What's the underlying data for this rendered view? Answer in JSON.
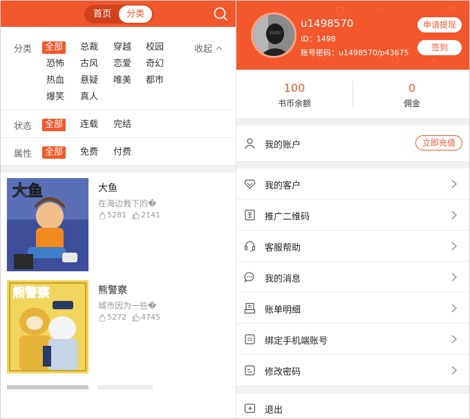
{
  "left": {
    "tabs": {
      "home": "首页",
      "category": "分类"
    },
    "filters": {
      "category_label": "分类",
      "categories": [
        "全部",
        "总裁",
        "穿越",
        "校园",
        "恐怖",
        "古风",
        "恋爱",
        "奇幻",
        "热血",
        "悬疑",
        "唯美",
        "都市",
        "爆笑",
        "真人"
      ],
      "collapse_label": "收起",
      "status_label": "状态",
      "status_options": [
        "全部",
        "连载",
        "完结"
      ],
      "attr_label": "属性",
      "attr_options": [
        "全部",
        "免费",
        "付费"
      ]
    },
    "books": [
      {
        "title": "大鱼",
        "desc": "在海边救下的�",
        "hot": "5281",
        "likes": "2141",
        "cover_text": "大鱼"
      },
      {
        "title": "熊警察",
        "desc": "城市因为一些�",
        "hot": "5272",
        "likes": "4745",
        "cover_text": "熊警察"
      }
    ]
  },
  "right": {
    "profile": {
      "username": "u1498570",
      "id_text": "ID：1498",
      "password_text": "账号密码：u1498570/p43675",
      "withdraw_label": "申请提现",
      "signin_label": "签到"
    },
    "balance": {
      "coins_value": "100",
      "coins_label": "书币余额",
      "commission_value": "0",
      "commission_label": "佣金"
    },
    "menu": {
      "account_label": "我的账户",
      "recharge_label": "立即充值",
      "items": [
        "我的客户",
        "推广二维码",
        "客服帮助",
        "我的消息",
        "账单明细",
        "绑定手机端账号",
        "修改密码"
      ],
      "logout_label": "退出"
    }
  },
  "colors": {
    "accent": "#f2582b",
    "divider": "#ececec",
    "muted": "#999999"
  }
}
